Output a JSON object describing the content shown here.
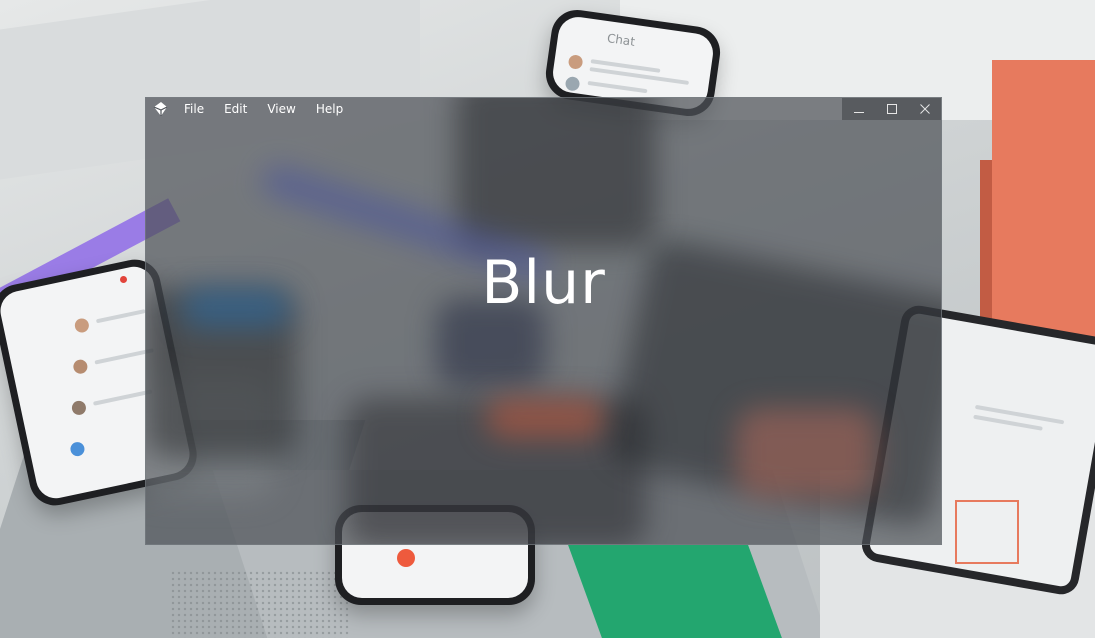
{
  "window": {
    "menu": [
      "File",
      "Edit",
      "View",
      "Help"
    ],
    "content_text": "Blur",
    "caption_buttons": {
      "minimize_icon": "minimize-icon",
      "maximize_icon": "maximize-icon",
      "close_icon": "close-icon"
    }
  },
  "wallpaper": {
    "phone_header_text": "Chat"
  },
  "colors": {
    "window_tint": "#4e5258",
    "text": "#ffffff",
    "accent_orange": "#e77a5e",
    "accent_purple": "#9a7ce6",
    "accent_green": "#23a66f"
  }
}
